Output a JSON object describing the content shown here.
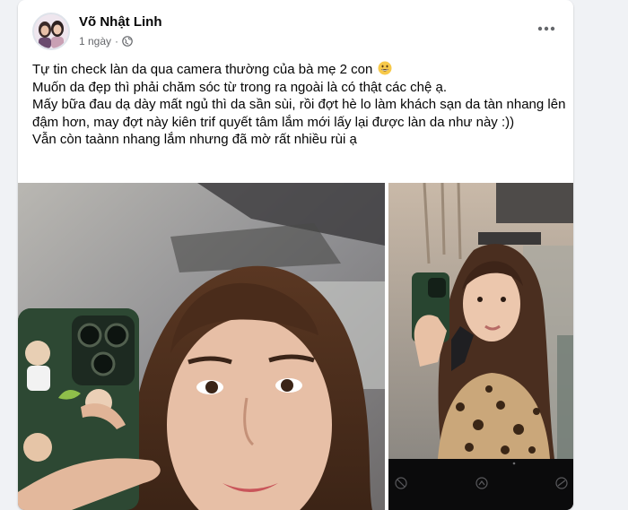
{
  "post": {
    "author": "Võ Nhật Linh",
    "time": "1 ngày",
    "separator": "·",
    "privacy_icon": "globe-icon",
    "more_icon": "more-options-icon",
    "lines": [
      "Tự tin check làn da qua camera thường của bà mẹ 2 con",
      "Muốn da đẹp thì phải chăm sóc từ trong ra ngoài là có thật các chệ ạ.",
      "Mấy bữa đau dạ dày mất ngủ thì da sần sùi, rồi đợt hè lo làm khách sạn da tàn nhang lên đậm hơn, may đợt này kiên trif quyết tâm lắm mới lấy lại được làn da như này :))",
      "Vẫn còn taànn nhang lắm nhưng đã mờ rất nhiều rùi ạ"
    ],
    "emoji": "grinning-face-emoji"
  },
  "photos": {
    "main": "selfie-closeup-photo",
    "side": "mirror-selfie-photo",
    "bar": "camera-controls-strip"
  },
  "colors": {
    "page_bg": "#f0f2f5",
    "card_bg": "#ffffff",
    "text": "#050505",
    "secondary_text": "#65676b"
  }
}
